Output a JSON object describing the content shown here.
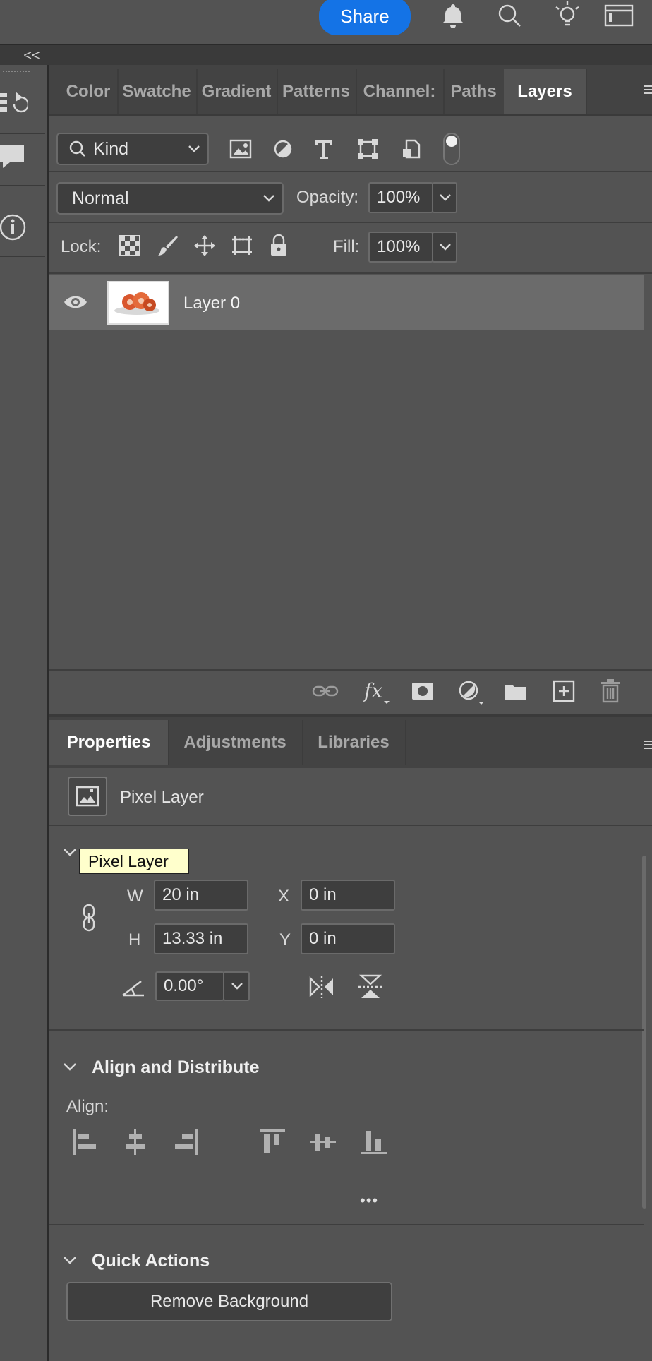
{
  "topbar": {
    "share_label": "Share",
    "collapse_label": "<<"
  },
  "layers_panel": {
    "tabs": [
      "Color",
      "Swatche",
      "Gradient",
      "Patterns",
      "Channel:",
      "Paths",
      "Layers"
    ],
    "active_tab": "Layers",
    "filter_label": "Kind",
    "blend_mode": "Normal",
    "opacity_label": "Opacity:",
    "opacity_value": "100%",
    "lock_label": "Lock:",
    "fill_label": "Fill:",
    "fill_value": "100%",
    "layers": [
      {
        "name": "Layer 0",
        "visible": true,
        "selected": true
      }
    ]
  },
  "properties_panel": {
    "tabs": [
      "Properties",
      "Adjustments",
      "Libraries"
    ],
    "active_tab": "Properties",
    "layer_type": "Pixel Layer",
    "tooltip": "Pixel Layer",
    "transform": {
      "w_label": "W",
      "w_value": "20 in",
      "h_label": "H",
      "h_value": "13.33 in",
      "x_label": "X",
      "x_value": "0 in",
      "y_label": "Y",
      "y_value": "0 in",
      "angle_value": "0.00°"
    },
    "align_section": {
      "title": "Align and Distribute",
      "align_label": "Align:",
      "more_label": "•••"
    },
    "quick_actions": {
      "title": "Quick Actions",
      "button_label": "Remove Background"
    }
  },
  "colors": {
    "accent": "#1473e6",
    "panel": "#535353",
    "selected_row": "#6b6b6b",
    "tooltip": "#ffffcc"
  }
}
